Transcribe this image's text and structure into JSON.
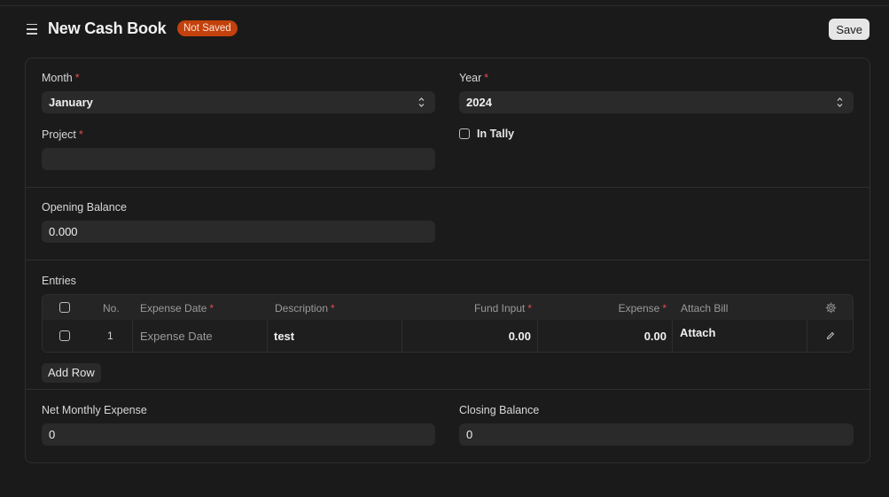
{
  "header": {
    "title": "New Cash Book",
    "status": "Not Saved",
    "save_label": "Save"
  },
  "fields": {
    "month": {
      "label": "Month",
      "value": "January"
    },
    "year": {
      "label": "Year",
      "value": "2024"
    },
    "project": {
      "label": "Project",
      "value": ""
    },
    "in_tally": {
      "label": "In Tally",
      "checked": false
    },
    "opening_balance": {
      "label": "Opening Balance",
      "value": "0.000"
    },
    "net_monthly_expense": {
      "label": "Net Monthly Expense",
      "value": "0"
    },
    "closing_balance": {
      "label": "Closing Balance",
      "value": "0"
    }
  },
  "entries": {
    "label": "Entries",
    "columns": {
      "no": "No.",
      "expense_date": "Expense Date",
      "description": "Description",
      "fund_input": "Fund Input",
      "expense": "Expense",
      "attach_bill": "Attach Bill"
    },
    "rows": [
      {
        "no": "1",
        "expense_date": "Expense Date",
        "description": "test",
        "fund_input": "0.00",
        "expense": "0.00",
        "attach_bill": "Attach"
      }
    ],
    "add_row_label": "Add Row"
  },
  "colors": {
    "background": "#1a1a1a",
    "badge": "#c2410c",
    "required": "#e24c4c"
  }
}
